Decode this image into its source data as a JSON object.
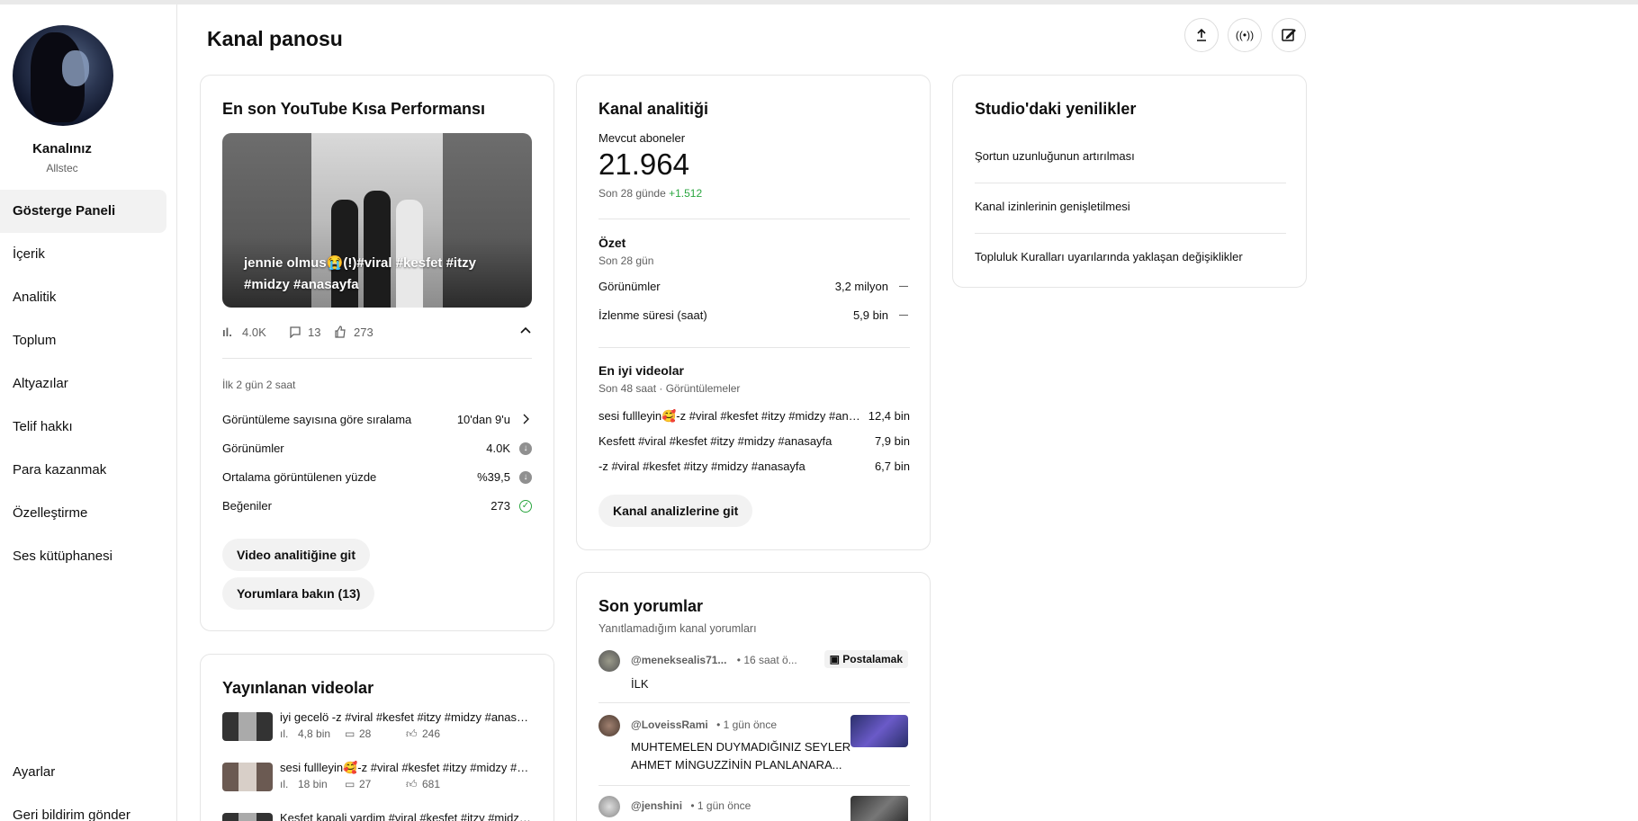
{
  "sidebar": {
    "channel_label": "Kanalınız",
    "channel_name": "Allstec",
    "items": [
      {
        "label": "Gösterge Paneli",
        "active": true
      },
      {
        "label": "İçerik"
      },
      {
        "label": "Analitik"
      },
      {
        "label": "Toplum"
      },
      {
        "label": "Altyazılar"
      },
      {
        "label": "Telif hakkı"
      },
      {
        "label": "Para kazanmak"
      },
      {
        "label": "Özelleştirme"
      },
      {
        "label": "Ses kütüphanesi"
      }
    ],
    "bottom": [
      {
        "label": "Ayarlar"
      },
      {
        "label": "Geri bildirim gönder"
      }
    ]
  },
  "header": {
    "title": "Kanal panosu",
    "upload_icon": "upload-icon",
    "live_icon": "live-broadcast-icon",
    "create_icon": "edit-post-icon"
  },
  "shorts_card": {
    "title": "En son YouTube Kısa Performansı",
    "video_title": "jennie olmus😭(!)#viral #kesfet #itzy #midzy #anasayfa",
    "views": "4.0K",
    "comments": "13",
    "likes": "273",
    "period": "İlk 2 gün 2 saat",
    "rows": [
      {
        "label": "Görüntüleme sayısına göre sıralama",
        "value": "10'dan 9'u",
        "icon": "chevron-right-icon"
      },
      {
        "label": "Görünümler",
        "value": "4.0K",
        "icon": "down-arrow-circle-icon"
      },
      {
        "label": "Ortalama görüntülenen yüzde",
        "value": "%39,5",
        "icon": "down-arrow-circle-icon"
      },
      {
        "label": "Beğeniler",
        "value": "273",
        "icon": "check-circle-icon"
      }
    ],
    "btn_analytics": "Video analitiğine git",
    "btn_comments": "Yorumlara bakın (13)"
  },
  "published_card": {
    "title": "Yayınlanan videolar",
    "videos": [
      {
        "title": "iyi gecelö -z #viral #kesfet #itzy #midzy #anasayfa",
        "views": "4,8 bin",
        "comments": "28",
        "likes": "246"
      },
      {
        "title": "sesi fullleyin🥰-z #viral #kesfet #itzy #midzy #anasayfa",
        "views": "18 bin",
        "comments": "27",
        "likes": "681"
      },
      {
        "title": "Kesfet kapali yardim #viral #kesfet #itzy #midzy #anasayfa",
        "views": "",
        "comments": "",
        "likes": ""
      }
    ]
  },
  "analytics_card": {
    "title": "Kanal analitiği",
    "subs_label": "Mevcut aboneler",
    "subs_value": "21.964",
    "subs_change_prefix": "Son 28 günde",
    "subs_change": "+1.512",
    "summary_title": "Özet",
    "summary_period": "Son 28 gün",
    "summary_rows": [
      {
        "label": "Görünümler",
        "value": "3,2 milyon",
        "trend": "—"
      },
      {
        "label": "İzlenme süresi (saat)",
        "value": "5,9 bin",
        "trend": "—"
      }
    ],
    "top_title": "En iyi videolar",
    "top_period": "Son 48 saat · Görüntülemeler",
    "top_videos": [
      {
        "title": "sesi fullleyin🥰-z #viral #kesfet #itzy #midzy #anasayfa",
        "views": "12,4 bin"
      },
      {
        "title": "Kesfett #viral #kesfet #itzy #midzy #anasayfa",
        "views": "7,9 bin"
      },
      {
        "title": "-z #viral #kesfet #itzy #midzy #anasayfa",
        "views": "6,7 bin"
      }
    ],
    "btn": "Kanal analizlerine git",
    "accent_green": "#2ba640"
  },
  "comments_card": {
    "title": "Son yorumlar",
    "subtitle": "Yanıtlamadığım kanal yorumları",
    "comments": [
      {
        "author": "@meneksealis71...",
        "time": "• 16 saat ö...",
        "text": "İLK",
        "badge": "Postalamak"
      },
      {
        "author": "@LoveissRami",
        "time": "• 1 gün önce",
        "text": "MUHTEMELEN DUYMADIĞINIZ SEYLER AHMET MİNGUZZİNİN PLANLANARA..."
      },
      {
        "author": "@jenshini",
        "time": "• 1 gün önce",
        "text": ""
      }
    ]
  },
  "news_card": {
    "title": "Studio'daki yenilikler",
    "items": [
      "Şortun uzunluğunun artırılması",
      "Kanal izinlerinin genişletilmesi",
      "Topluluk Kuralları uyarılarında yaklaşan değişiklikler"
    ]
  }
}
